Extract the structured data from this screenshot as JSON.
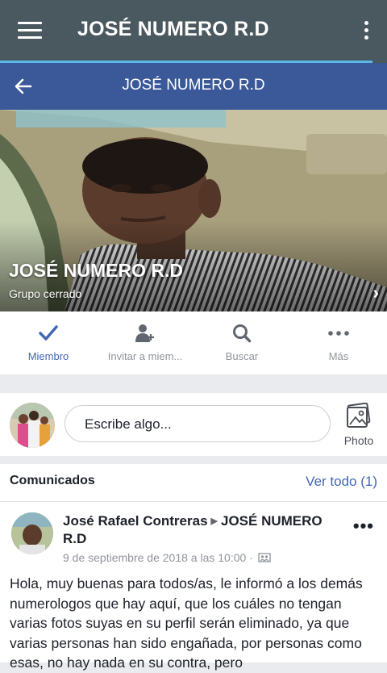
{
  "app_bar": {
    "title": "JOSÉ NUMERO R.D"
  },
  "fb_bar": {
    "title": "JOSÉ NUMERO R.D"
  },
  "cover": {
    "group_name": "JOSÉ NUMERO R.D",
    "group_type": "Grupo cerrado"
  },
  "actions": [
    {
      "label": "Miembro",
      "icon": "check-icon"
    },
    {
      "label": "Invitar a miem...",
      "icon": "add-person-icon"
    },
    {
      "label": "Buscar",
      "icon": "search-icon"
    },
    {
      "label": "Más",
      "icon": "more-icon"
    }
  ],
  "composer": {
    "placeholder": "Escribe algo...",
    "photo_label": "Photo"
  },
  "announcements": {
    "heading": "Comunicados",
    "see_all": "Ver todo (1)",
    "post": {
      "author": "José Rafael Contreras",
      "group": "JOSÉ NUMERO R.D",
      "date": "9 de septiembre de 2018 a las 10:00 ·",
      "body": "Hola, muy buenas para todos/as, le informó a los demás numerologos que hay aquí, que los cuáles no tengan varias fotos suyas en su perfil serán eliminado, ya que varias personas han sido engañada, por personas como esas, no hay nada en su contra, pero"
    }
  },
  "colors": {
    "app_bar": "#4a585f",
    "fb_blue": "#3b5998",
    "accent": "#4267b2",
    "accent_line": "#5ab7e8"
  }
}
